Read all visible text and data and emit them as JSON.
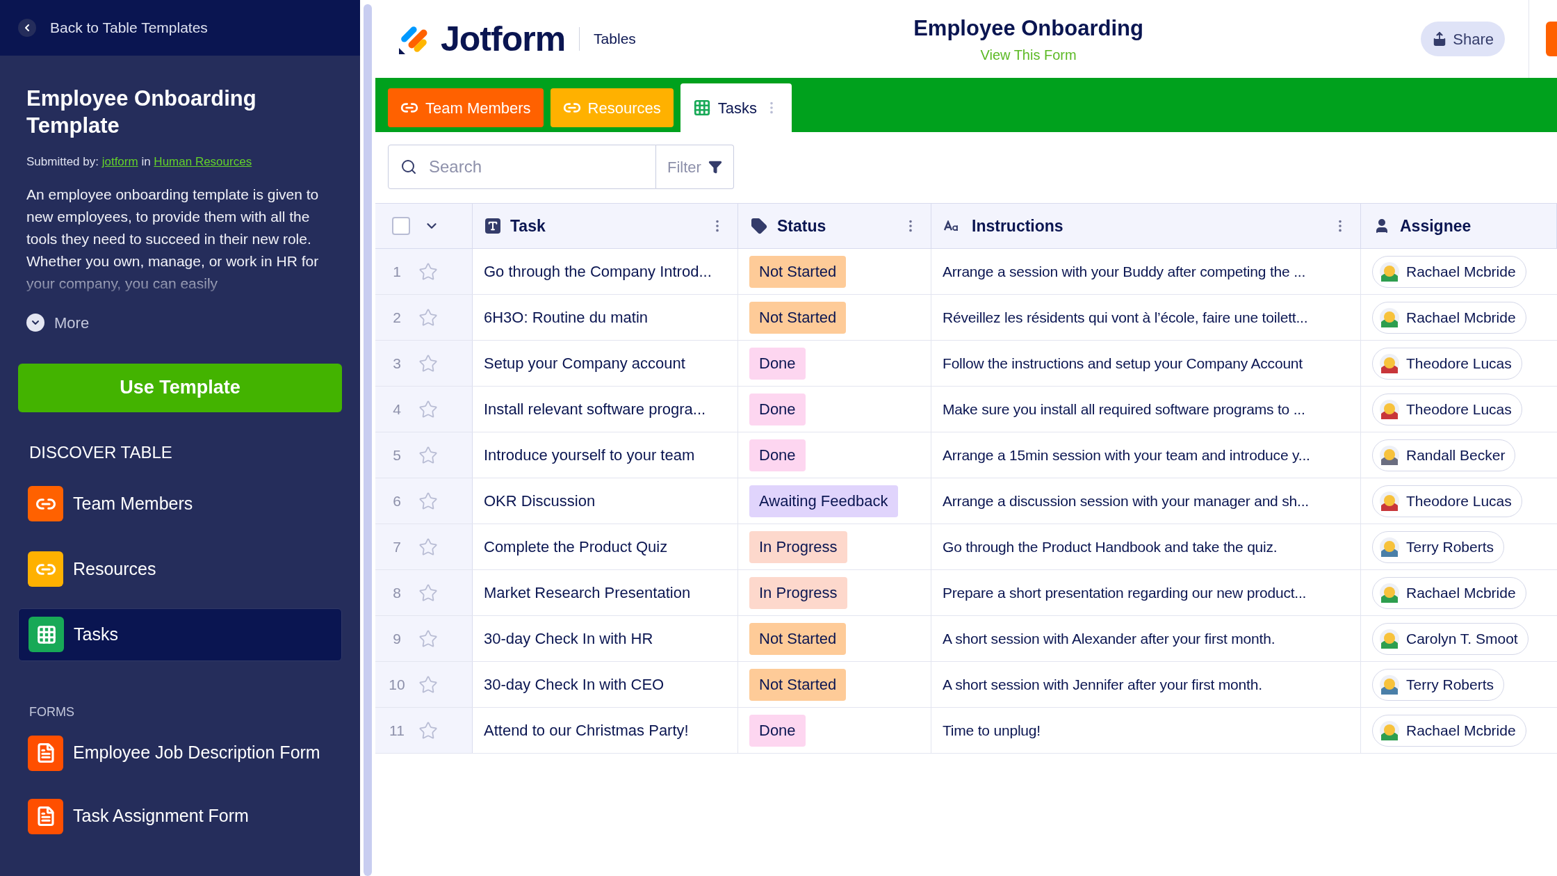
{
  "sidebar": {
    "back_link": "Back to Table Templates",
    "title": "Employee Onboarding Template",
    "submitted_by": {
      "prefix": "Submitted by:",
      "author": "jotform",
      "joiner": "in",
      "category": "Human Resources"
    },
    "description": "An employee onboarding template is given to new employees, to provide them with all the tools they need to succeed in their new role. Whether you own, manage, or work in HR for your company, you can easily",
    "more": "More",
    "use_template": "Use Template",
    "discover_heading": "DISCOVER TABLE",
    "tables": [
      {
        "label": "Team Members",
        "kind": "link",
        "color": "#ff6100",
        "selected": false
      },
      {
        "label": "Resources",
        "kind": "link",
        "color": "#ffb100",
        "selected": false
      },
      {
        "label": "Tasks",
        "kind": "grid",
        "color": "#18a957",
        "selected": true
      }
    ],
    "forms_heading": "FORMS",
    "forms": [
      {
        "label": "Employee Job Description Form"
      },
      {
        "label": "Task Assignment Form"
      }
    ]
  },
  "header": {
    "brand": "Jotform",
    "product": "Tables",
    "title": "Employee Onboarding",
    "subtitle": "View This Form",
    "share": "Share"
  },
  "tabs": [
    {
      "label": "Team Members",
      "kind": "link",
      "color": "#ff6100",
      "selected": false
    },
    {
      "label": "Resources",
      "kind": "link",
      "color": "#ffb100",
      "selected": false
    },
    {
      "label": "Tasks",
      "kind": "grid",
      "color": "#ffffff",
      "selected": true
    }
  ],
  "search": {
    "placeholder": "Search",
    "filter": "Filter"
  },
  "table": {
    "select_all_checked": false,
    "columns": [
      {
        "label": "Task",
        "kind": "text-type",
        "menu": true
      },
      {
        "label": "Status",
        "kind": "tag",
        "menu": true
      },
      {
        "label": "Instructions",
        "kind": "aa",
        "menu": true
      },
      {
        "label": "Assignee",
        "kind": "person",
        "menu": false
      }
    ],
    "rows": [
      {
        "number": "1",
        "starred": false,
        "task": "Go through the Company Introd...",
        "status": {
          "label": "Not Started",
          "color": "#fecb98"
        },
        "instructions": "Arrange a session with your Buddy after competing the ...",
        "assignee": {
          "name": "Rachael Mcbride",
          "color": "#2e9e4f"
        }
      },
      {
        "number": "2",
        "starred": false,
        "task": "6H3O: Routine du matin",
        "status": {
          "label": "Not Started",
          "color": "#fecb98"
        },
        "instructions": "Réveillez les résidents qui vont à l’école, faire une toilett...",
        "assignee": {
          "name": "Rachael Mcbride",
          "color": "#2e9e4f"
        }
      },
      {
        "number": "3",
        "starred": false,
        "task": "Setup your Company account",
        "status": {
          "label": "Done",
          "color": "#fdd6f0"
        },
        "instructions": "Follow the instructions and setup your Company Account",
        "assignee": {
          "name": "Theodore Lucas",
          "color": "#c8363a"
        }
      },
      {
        "number": "4",
        "starred": false,
        "task": "Install relevant software progra...",
        "status": {
          "label": "Done",
          "color": "#fdd6f0"
        },
        "instructions": "Make sure you install all required software programs to ...",
        "assignee": {
          "name": "Theodore Lucas",
          "color": "#c8363a"
        }
      },
      {
        "number": "5",
        "starred": false,
        "task": "Introduce yourself to your team",
        "status": {
          "label": "Done",
          "color": "#fdd6f0"
        },
        "instructions": "Arrange a 15min session with your team and introduce y...",
        "assignee": {
          "name": "Randall Becker",
          "color": "#6b6e80"
        }
      },
      {
        "number": "6",
        "starred": false,
        "task": "OKR Discussion",
        "status": {
          "label": "Awaiting Feedback",
          "color": "#e0d4fc"
        },
        "instructions": "Arrange a discussion session with your manager and sh...",
        "assignee": {
          "name": "Theodore Lucas",
          "color": "#c8363a"
        }
      },
      {
        "number": "7",
        "starred": false,
        "task": "Complete the Product Quiz",
        "status": {
          "label": "In Progress",
          "color": "#fdd8cc"
        },
        "instructions": "Go through the Product Handbook and take the quiz.",
        "assignee": {
          "name": "Terry Roberts",
          "color": "#4a7fa8"
        }
      },
      {
        "number": "8",
        "starred": false,
        "task": "Market Research Presentation",
        "status": {
          "label": "In Progress",
          "color": "#fdd8cc"
        },
        "instructions": "Prepare a short presentation regarding our new product...",
        "assignee": {
          "name": "Rachael Mcbride",
          "color": "#2e9e4f"
        }
      },
      {
        "number": "9",
        "starred": false,
        "task": "30-day Check In with HR",
        "status": {
          "label": "Not Started",
          "color": "#fecb98"
        },
        "instructions": "A short session with Alexander after your first month.",
        "assignee": {
          "name": "Carolyn T. Smoot",
          "color": "#2e9e4f"
        }
      },
      {
        "number": "10",
        "starred": false,
        "task": "30-day Check In with CEO",
        "status": {
          "label": "Not Started",
          "color": "#fecb98"
        },
        "instructions": "A short session with Jennifer after your first month.",
        "assignee": {
          "name": "Terry Roberts",
          "color": "#4a7fa8"
        }
      },
      {
        "number": "11",
        "starred": false,
        "task": "Attend to our Christmas Party!",
        "status": {
          "label": "Done",
          "color": "#fdd6f0"
        },
        "instructions": "Time to unplug!",
        "assignee": {
          "name": "Rachael Mcbride",
          "color": "#2e9e4f"
        }
      }
    ]
  }
}
